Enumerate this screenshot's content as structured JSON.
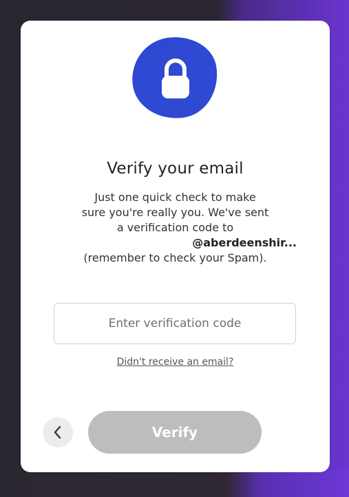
{
  "dialog": {
    "title": "Verify your email",
    "description_lines": [
      "Just one quick check to make",
      "sure you're really you. We've sent",
      "a verification code to"
    ],
    "email": "@aberdeenshir...",
    "spam_note": "(remember to check your Spam).",
    "code_input": {
      "placeholder": "Enter verification code",
      "value": ""
    },
    "resend_link": "Didn't receive an email?",
    "verify_button": "Verify",
    "verify_enabled": false,
    "back_icon": "chevron-left-icon",
    "header_icon": "lock-icon"
  },
  "colors": {
    "badge": "#2f49d2",
    "verify_disabled": "#bdbdbd",
    "back_bg": "#ececec",
    "accent_purple": "#6a35d0"
  }
}
